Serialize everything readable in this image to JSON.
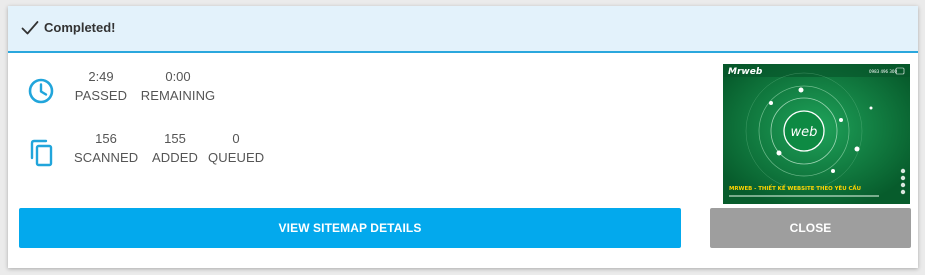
{
  "header": {
    "status": "Completed!",
    "icon": "check-icon"
  },
  "time_stats": [
    {
      "value": "2:49",
      "label": "PASSED"
    },
    {
      "value": "0:00",
      "label": "REMAINING"
    }
  ],
  "scan_stats": [
    {
      "value": "156",
      "label": "SCANNED"
    },
    {
      "value": "155",
      "label": "ADDED"
    },
    {
      "value": "0",
      "label": "QUEUED"
    }
  ],
  "thumbnail": {
    "brand": "Mrweb",
    "logo_text": "web",
    "phone": "0983 496 300",
    "headline": "MRWEB - THIẾT KẾ WEBSITE THEO YÊU CẦU"
  },
  "actions": {
    "details_label": "VIEW SITEMAP DETAILS",
    "close_label": "CLOSE"
  },
  "colors": {
    "accent": "#03a9ed",
    "header_bg": "#e3f2fb",
    "close_bg": "#9e9e9e",
    "icon_blue": "#21a5db",
    "thumb_green": "#0b7a3c"
  }
}
